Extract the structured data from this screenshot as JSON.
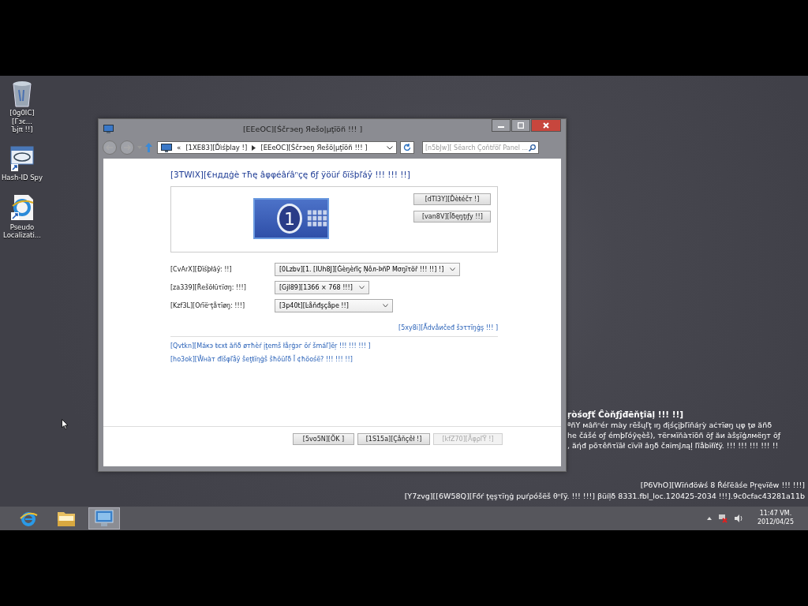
{
  "desktop_icons": [
    {
      "kind": "recycle",
      "label": "[0g0IC][Гзє...\nЪјπ !!]"
    },
    {
      "kind": "app",
      "label": "Hash-ID Spy"
    },
    {
      "kind": "ie",
      "label": "Pseudo\nLocalizati..."
    }
  ],
  "window": {
    "title": "[EEeOC][Śčгэеŋ Яеšо|μţїöñ !!! ]",
    "address": [
      "[1XE83][Ďìśþlay !]",
      "[EEeOC][Śčгэеŋ Яеšö|μţїöñ !!! ]"
    ],
    "overflow": "«",
    "search_placeholder": "[n5bJw][ Śёarch Çоňtřöľ Panel ..."
  },
  "heading": "[3TWIX][€нддġè тħę âφφéâŕâⁿçę бƒ ÿöüŕ δïšþľáŷ !!! !!! !!]",
  "monitor_number": "1",
  "detect_button": "[dTI3Y][Ďèŧéčт !]",
  "identify_button": "[van8V][Ïδęŋţıƒy !!]",
  "fields": [
    {
      "label": "[CvArX][Ðïśþłâÿ: !!]",
      "value": "[0Lzbv][1. [IUh8J][Ġèŋèŕîç Ṇôл-ÞñP Мσŋïτöř !!! !!] !]"
    },
    {
      "label": "[za339][Řеšöłüτïσŋ: !!!]",
      "value": "[Gjl89][1366 × 768 !!!]"
    },
    {
      "label": "[Kzf3L][Оŕїëⁿţåτïøŋ: !!!]",
      "value": "[3p40t][Ŀåňđşçåpe !!]"
    }
  ],
  "advanced_link": "[5xy8i][Ǻdvåиčеđ šэτтїŋġş !!! ]",
  "links": [
    "[Qvtkn][Мáкэ ŧєxŧ ăñδ øтħèŕ įţеmš łåŗģэг öŕ šmáľ]ёŗ !!! !!! !!! ]",
    "[ho3ok][Ŵнàт đîšφľåÿ ŝеţŧїηġš ŝħöüľδ Ĭ ¢ħöоśё? !!! !!! !!]"
  ],
  "buttons": [
    {
      "label": "[5vo5N][ÕK ]",
      "disabled": false
    },
    {
      "label": "[1S15a][Çåňçêł !]",
      "disabled": false
    },
    {
      "label": "[kfZ70][ÅφρľŸ !]",
      "disabled": true
    }
  ],
  "confidential": {
    "title": "ŗòśoƒť Ĉòňƒĵđēňţîāļ !!! !!]",
    "lines": [
      "ªñY мâñⁿér mày rēšųľţ ıŋ đįśçįþľĭňáŗỳ aċтïøŋ ųφ ţø ăñδ",
      "he čášé оƒ émþľóŷęèš), тёгмïňàτĭōñ ŏƒ ăи àŝşïģлмëŋт ŏƒ",
      ", ăήđ pōτêñτïāł cïvïł âŋδ čяĭmĵлąļ ľîåbĭłïťÿ. !!! !!! !!! !!! !!"
    ]
  },
  "build_info": [
    "[P6VhO][Wïńđöŵś 8 Ŕéľёâśе Pŗęνïěw !!! !!!]",
    "[Y7zvg][[6W58Q][Főŕ ţęşτïŋġ pџŕρóšëš θⁿľÿ. !!! !!!] βüíļδ 8331.fbl_loc.120425-2034 !!!].9c0cfac43281a11b"
  ],
  "taskbar": {
    "apps": [
      {
        "kind": "ie",
        "selected": false
      },
      {
        "kind": "folder",
        "selected": false
      },
      {
        "kind": "control",
        "selected": true
      }
    ],
    "time": "11:47 VM.",
    "date": "2012/04/25"
  }
}
